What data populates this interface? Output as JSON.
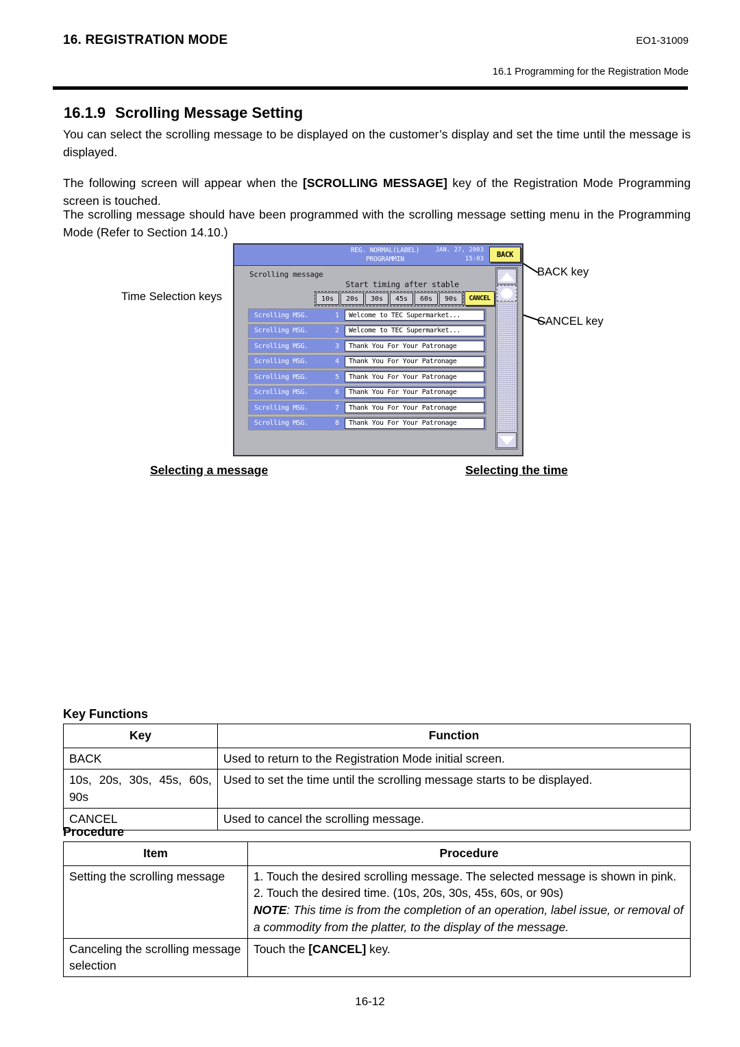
{
  "header": {
    "chapter": "16. REGISTRATION MODE",
    "doc_number": "EO1-31009",
    "subtitle": "16.1 Programming for the Registration Mode"
  },
  "section": {
    "number": "16.1.9",
    "title": "Scrolling Message Setting",
    "para1": "You can select the scrolling message to be displayed on the customer’s display and set the time until the message is displayed.",
    "para2_before": "The following screen will appear when the ",
    "para2_bold": "[SCROLLING MESSAGE]",
    "para2_after": " key of the Registration Mode Programming screen is touched.",
    "para3": "The scrolling message should have been programmed with the scrolling message setting menu in the Programming Mode (Refer to Section 14.10.)"
  },
  "figure": {
    "callouts": {
      "time_selection": "Time Selection keys",
      "back_key": "BACK key",
      "cancel_key": "CANCEL key"
    },
    "captions": {
      "selecting_message": "Selecting a message",
      "selecting_time": "Selecting the time"
    },
    "device": {
      "titlebar": {
        "mode_line1": "REG. NORMAL(LABEL)",
        "mode_line2": "PROGRAMMIN",
        "date": "JAN. 27, 2003",
        "time": "15:03",
        "back_label": "BACK"
      },
      "panel_label": "Scrolling message",
      "start_timing_label": "Start timing after stable",
      "time_keys": [
        "10s",
        "20s",
        "30s",
        "45s",
        "60s",
        "90s"
      ],
      "cancel_label": "CANCEL",
      "messages": [
        {
          "label": "Scrolling MSG.",
          "index": "1",
          "text": "Welcome to TEC Supermarket..."
        },
        {
          "label": "Scrolling MSG.",
          "index": "2",
          "text": "Welcome to TEC Supermarket..."
        },
        {
          "label": "Scrolling MSG.",
          "index": "3",
          "text": "Thank You For Your Patronage"
        },
        {
          "label": "Scrolling MSG.",
          "index": "4",
          "text": "Thank You For Your Patronage"
        },
        {
          "label": "Scrolling MSG.",
          "index": "5",
          "text": "Thank You For Your Patronage"
        },
        {
          "label": "Scrolling MSG.",
          "index": "6",
          "text": "Thank You For Your Patronage"
        },
        {
          "label": "Scrolling MSG.",
          "index": "7",
          "text": "Thank You For Your Patronage"
        },
        {
          "label": "Scrolling MSG.",
          "index": "8",
          "text": "Thank You For Your Patronage"
        }
      ],
      "colors": {
        "titlebar_blue": "#7f8fe0",
        "row_blue": "#7f8fe0",
        "key_yellow": "#f7f27a",
        "panel_gray": "#b6b6bd"
      }
    }
  },
  "key_functions": {
    "heading": "Key Functions",
    "columns": [
      "Key",
      "Function"
    ],
    "rows": [
      {
        "key": "BACK",
        "function": "Used to return to the Registration Mode initial screen."
      },
      {
        "key": "10s, 20s, 30s, 45s, 60s, 90s",
        "function": "Used to set the time until the scrolling message starts to be displayed."
      },
      {
        "key": "CANCEL",
        "function": "Used to cancel the scrolling message."
      }
    ]
  },
  "procedure": {
    "heading": "Procedure",
    "columns": [
      "Item",
      "Procedure"
    ],
    "rows": [
      {
        "item": "Setting the scrolling message",
        "step1": "1. Touch the desired scrolling message.  The selected message is shown in pink.",
        "step2": "2. Touch the desired time. (10s, 20s, 30s, 45s, 60s, or 90s)",
        "note_label": "NOTE",
        "note_text": ": This time is from the completion of an operation, label issue, or removal of a commodity from the platter, to the display of the message."
      },
      {
        "item": "Canceling the scrolling message selection",
        "action_before": "Touch the ",
        "action_bold": "[CANCEL]",
        "action_after": " key."
      }
    ]
  },
  "footer": {
    "page_number": "16-12"
  }
}
